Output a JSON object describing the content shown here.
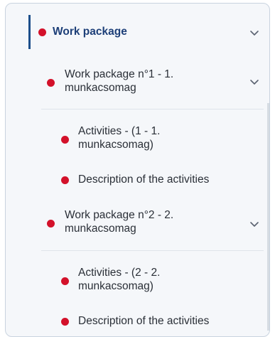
{
  "tree": {
    "root": {
      "label": "Work package",
      "expanded": true,
      "chevron_icon": "chevron-down-icon"
    },
    "packages": [
      {
        "label": "Work package n°1 - 1. munkacsomag",
        "line1": "Work package n°1 - 1.",
        "line2": "munkacsomag",
        "chevron_icon": "chevron-down-icon",
        "children": [
          {
            "line1": "Activities - (1 - 1.",
            "line2": "munkacsomag)"
          },
          {
            "line1": "Description of the activities"
          }
        ]
      },
      {
        "label": "Work package n°2 - 2. munkacsomag",
        "line1": "Work package n°2 - 2.",
        "line2": "munkacsomag",
        "chevron_icon": "chevron-down-icon",
        "children": [
          {
            "line1": "Activities - (2 - 2.",
            "line2": "munkacsomag)"
          },
          {
            "line1": "Description of the activities"
          }
        ]
      }
    ]
  },
  "colors": {
    "bullet": "#d3112a",
    "active_bar": "#1d4f8b",
    "active_text": "#1d3f78",
    "panel_bg": "#f5f7fa",
    "border": "#c9d3df"
  }
}
